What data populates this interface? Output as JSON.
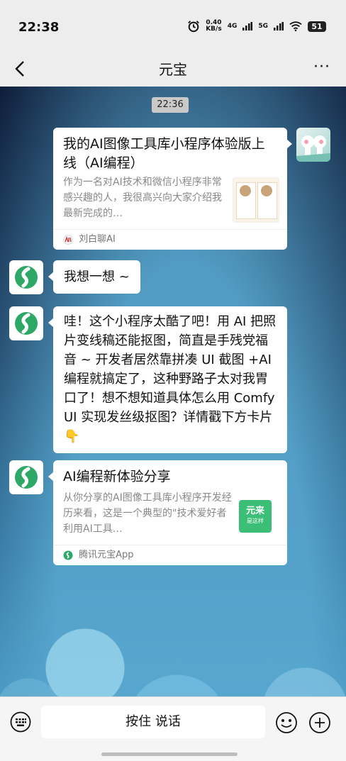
{
  "status_bar": {
    "time": "22:38",
    "net_speed_value": "0.40",
    "net_speed_unit": "KB/s",
    "signal1": "4G",
    "signal2": "5G",
    "battery": "51"
  },
  "navbar": {
    "title": "元宝",
    "more": "···"
  },
  "chat": {
    "timestamp": "22:36",
    "messages": [
      {
        "sender": "user",
        "type": "card",
        "title": "我的AI图像工具库小程序体验版上线（AI编程）",
        "desc": "作为一名对AI技术和微信小程序非常感兴趣的人，我很高兴向大家介绍我最新完成的…",
        "source": "刘白聊AI"
      },
      {
        "sender": "bot",
        "type": "text",
        "text": "我想一想 ~"
      },
      {
        "sender": "bot",
        "type": "text",
        "text": "哇！这个小程序太酷了吧！用 AI 把照片变线稿还能抠图，简直是手残党福音 ~ 开发者居然靠拼凑 UI 截图 +AI 编程就搞定了，这种野路子太对我胃口了！想不想知道具体怎么用 ComfyUI 实现发丝级抠图？详情戳下方卡片👇"
      },
      {
        "sender": "bot",
        "type": "card",
        "title": "AI编程新体验分享",
        "desc": "从你分享的AI图像工具库小程序开发经历来看，这是一个典型的\"技术爱好者利用AI工具…",
        "thumb_text_1": "元来",
        "thumb_text_2": "是这样",
        "source": "腾讯元宝App"
      }
    ]
  },
  "input_bar": {
    "voice_label": "按住 说话"
  },
  "colors": {
    "bot_green": "#2ea866",
    "thumb_green": "#3bbf76"
  }
}
